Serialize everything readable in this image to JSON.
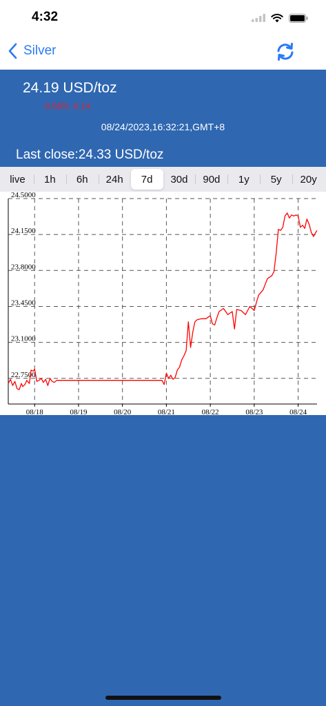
{
  "status_bar": {
    "time": "4:32"
  },
  "nav": {
    "back_label": "Silver",
    "refresh_icon": "refresh-icon"
  },
  "quote": {
    "price": "24.19 USD/toz",
    "change": "-0.58% -0.14",
    "timestamp": "08/24/2023,16:32:21,GMT+8",
    "last_close": "Last close:24.33 USD/toz"
  },
  "tabs": [
    "live",
    "1h",
    "6h",
    "24h",
    "7d",
    "30d",
    "90d",
    "1y",
    "5y",
    "20y"
  ],
  "active_tab": "7d",
  "colors": {
    "background": "#2f67b1",
    "line": "#ff0000",
    "change": "#e8212b",
    "accent": "#2a7af5"
  },
  "chart_data": {
    "type": "line",
    "title": "",
    "xlabel": "",
    "ylabel": "",
    "grid": true,
    "ylim": [
      22.5,
      24.5
    ],
    "y_ticks": [
      "24.5000",
      "24.1500",
      "23.8000",
      "23.4500",
      "23.1000",
      "22.7500"
    ],
    "x_ticks": [
      "08/18",
      "08/19",
      "08/20",
      "08/21",
      "08/22",
      "08/23",
      "08/24"
    ],
    "x_tick_positions": [
      0,
      1,
      2,
      3,
      4,
      5,
      6
    ],
    "xlim": [
      -0.6,
      6.43
    ],
    "series": [
      {
        "x": [
          -0.6,
          -0.55,
          -0.5,
          -0.45,
          -0.4,
          -0.35,
          -0.3,
          -0.27,
          -0.22,
          -0.18,
          -0.12,
          -0.08,
          -0.03,
          0.0,
          0.05,
          0.1,
          0.15,
          0.2,
          0.25,
          0.3,
          0.35,
          0.4,
          0.45,
          0.5,
          0.55,
          0.6,
          0.7,
          0.8,
          0.9,
          1.0,
          1.2,
          1.5,
          1.8,
          2.0,
          2.2,
          2.5,
          2.8,
          2.9,
          2.95,
          3.0,
          3.05,
          3.1,
          3.15,
          3.2,
          3.25,
          3.3,
          3.35,
          3.4,
          3.45,
          3.5,
          3.55,
          3.6,
          3.65,
          3.7,
          3.8,
          3.9,
          4.0,
          4.05,
          4.1,
          4.15,
          4.2,
          4.3,
          4.4,
          4.5,
          4.55,
          4.6,
          4.7,
          4.8,
          4.9,
          5.0,
          5.05,
          5.1,
          5.2,
          5.3,
          5.4,
          5.45,
          5.5,
          5.55,
          5.6,
          5.65,
          5.7,
          5.75,
          5.8,
          5.85,
          5.9,
          5.95,
          6.0,
          6.05,
          6.1,
          6.15,
          6.2,
          6.25,
          6.3,
          6.35,
          6.4,
          6.43
        ],
        "y": [
          22.7,
          22.74,
          22.68,
          22.72,
          22.65,
          22.64,
          22.7,
          22.67,
          22.69,
          22.73,
          22.7,
          22.83,
          22.82,
          22.84,
          22.72,
          22.73,
          22.75,
          22.71,
          22.74,
          22.68,
          22.75,
          22.72,
          22.71,
          22.73,
          22.73,
          22.73,
          22.73,
          22.73,
          22.73,
          22.73,
          22.73,
          22.73,
          22.73,
          22.73,
          22.73,
          22.73,
          22.73,
          22.73,
          22.69,
          22.8,
          22.75,
          22.78,
          22.74,
          22.76,
          22.83,
          22.86,
          22.93,
          22.97,
          23.02,
          23.3,
          23.05,
          23.2,
          23.3,
          23.32,
          23.33,
          23.33,
          23.36,
          23.28,
          23.27,
          23.34,
          23.4,
          23.43,
          23.37,
          23.4,
          23.23,
          23.42,
          23.41,
          23.37,
          23.45,
          23.41,
          23.49,
          23.56,
          23.61,
          23.72,
          23.75,
          23.79,
          23.97,
          24.2,
          24.19,
          24.22,
          24.33,
          24.36,
          24.31,
          24.34,
          24.33,
          24.34,
          24.33,
          24.22,
          24.24,
          24.21,
          24.3,
          24.25,
          24.17,
          24.13,
          24.17,
          24.19
        ]
      }
    ]
  }
}
